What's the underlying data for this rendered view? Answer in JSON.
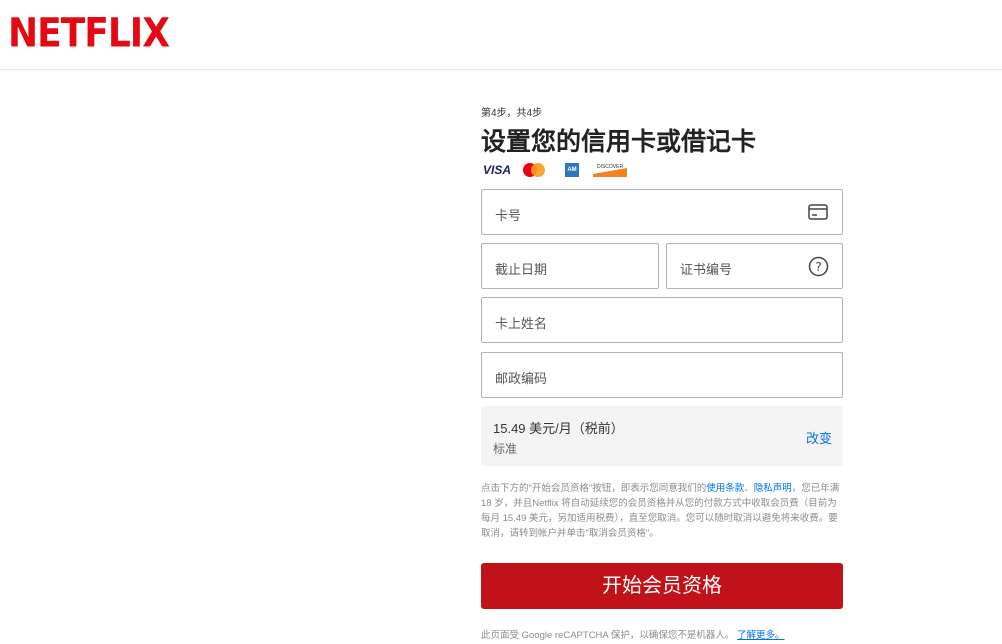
{
  "brand": {
    "logo_text": "NETFLIX",
    "color": "#e50914"
  },
  "form": {
    "step": "第4步，共4步",
    "title": "设置您的信用卡或借记卡",
    "card_brands": {
      "visa": "VISA",
      "amex": "AM",
      "discover": "DISCOVER"
    },
    "fields": {
      "card_number": "卡号",
      "expiry": "截止日期",
      "cvv": "证书编号",
      "name": "卡上姓名",
      "zip": "邮政编码"
    },
    "plan": {
      "price": "15.49 美元/月（税前）",
      "name": "标准",
      "change": "改变"
    },
    "legal": {
      "part1": "点击下方的\"开始会员资格\"按钮，即表示您同意我们的",
      "terms_link": "使用条款",
      "sep": "、",
      "privacy_link": "隐私声明",
      "part2": "，您已年满 18 岁，并且Netflix 将自动延续您的会员资格并从您的付款方式中收取会员费（目前为每月 15.49 美元，另加适用税费），直至您取消。您可以随时取消以避免将来收费。要取消，请转到帐户并单击\"取消会员资格\"。"
    },
    "cta": "开始会员资格",
    "recaptcha": {
      "text": "此页面受 Google reCAPTCHA 保护，以确保您不是机器人。",
      "link": "了解更多。"
    }
  },
  "colors": {
    "cta": "#c11119",
    "link": "#0071eb"
  }
}
